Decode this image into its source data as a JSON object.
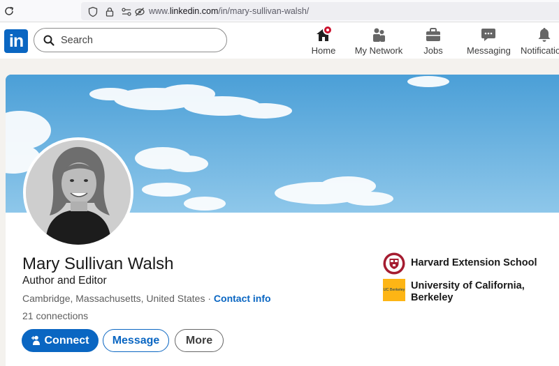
{
  "browser": {
    "url_prefix": "www.",
    "url_domain": "linkedin.com",
    "url_path": "/in/mary-sullivan-walsh/"
  },
  "nav": {
    "logo": "in",
    "search_placeholder": "Search",
    "items": [
      {
        "label": "Home",
        "icon": "home-icon"
      },
      {
        "label": "My Network",
        "icon": "network-icon"
      },
      {
        "label": "Jobs",
        "icon": "briefcase-icon"
      },
      {
        "label": "Messaging",
        "icon": "messaging-icon"
      },
      {
        "label": "Notifications",
        "icon": "bell-icon"
      }
    ]
  },
  "profile": {
    "name": "Mary Sullivan Walsh",
    "headline": "Author and Editor",
    "location": "Cambridge, Massachusetts, United States",
    "separator": " · ",
    "contact_info": "Contact info",
    "connections": "21 connections",
    "buttons": {
      "connect": "Connect",
      "message": "Message",
      "more": "More"
    },
    "education": [
      {
        "name_line1": "Harvard Extension School",
        "name_line2": "",
        "logo": "harvard-shield"
      },
      {
        "name_line1": "University of California,",
        "name_line2": "Berkeley",
        "logo_text": "UC Berkeley",
        "logo": "uc-berkeley"
      }
    ]
  },
  "colors": {
    "linkedin_blue": "#0a66c2",
    "notification_red": "#cb112d",
    "banner_sky": "#5aaade",
    "harvard_crimson": "#a51c30",
    "berkeley_gold": "#fdb515"
  }
}
